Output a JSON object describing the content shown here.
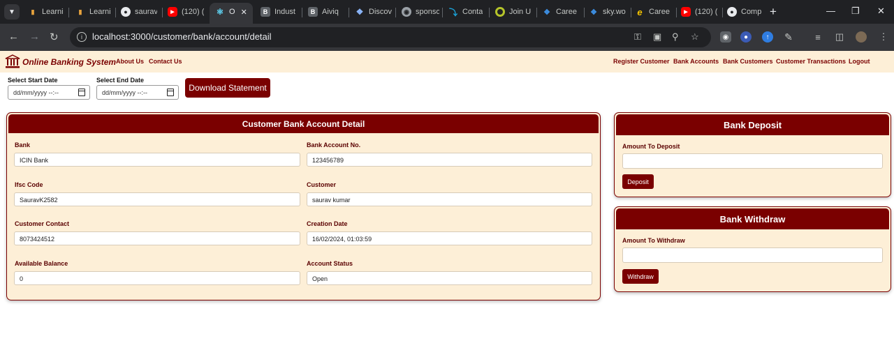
{
  "browser": {
    "tabs": [
      {
        "title": "Learni",
        "favicon": "bar-chart-icon",
        "color": "#e8a33d"
      },
      {
        "title": "Learni",
        "favicon": "bar-chart-icon",
        "color": "#e8a33d"
      },
      {
        "title": "saurav",
        "favicon": "github-icon",
        "color": "#e8eaed"
      },
      {
        "title": "(120) (",
        "favicon": "youtube-icon",
        "color": "#ff0000"
      },
      {
        "title": "O",
        "favicon": "react-icon",
        "color": "#61dafb",
        "active": true
      },
      {
        "title": "Indust",
        "favicon": "b-icon",
        "color": "#5f6368"
      },
      {
        "title": "Aiviq",
        "favicon": "b-icon",
        "color": "#5f6368"
      },
      {
        "title": "Discov",
        "favicon": "discover-icon",
        "color": "#8ab4f8"
      },
      {
        "title": "sponso",
        "favicon": "globe-icon",
        "color": "#9aa0a6"
      },
      {
        "title": "Conta",
        "favicon": "hook-icon",
        "color": "#1aa3d9"
      },
      {
        "title": "Join U",
        "favicon": "circle-icon",
        "color": "#b5c42a"
      },
      {
        "title": "Caree",
        "favicon": "w-icon",
        "color": "#3c8de0"
      },
      {
        "title": "sky.wo",
        "favicon": "w-icon",
        "color": "#3c8de0"
      },
      {
        "title": "Caree",
        "favicon": "e-icon",
        "color": "#f5c400"
      },
      {
        "title": "(120) (",
        "favicon": "youtube-icon",
        "color": "#ff0000"
      },
      {
        "title": "Comp",
        "favicon": "github-icon",
        "color": "#e8eaed"
      }
    ],
    "url": "localhost:3000/customer/bank/account/detail"
  },
  "navbar": {
    "brand": "Online Banking System",
    "left_links": [
      "About Us",
      "Contact Us"
    ],
    "right_links": [
      "Register Customer",
      "Bank Accounts",
      "Bank Customers",
      "Customer Transactions",
      "Logout"
    ]
  },
  "filter": {
    "start_label": "Select Start Date",
    "end_label": "Select End Date",
    "date_placeholder": "dd/mm/yyyy --:--",
    "download_label": "Download Statement"
  },
  "account": {
    "title": "Customer Bank Account Detail",
    "fields": [
      {
        "label": "Bank",
        "value": "ICIN Bank"
      },
      {
        "label": "Bank Account No.",
        "value": "123456789"
      },
      {
        "label": "Ifsc Code",
        "value": "SauravK2582"
      },
      {
        "label": "Customer",
        "value": "saurav kumar"
      },
      {
        "label": "Customer Contact",
        "value": "8073424512"
      },
      {
        "label": "Creation Date",
        "value": "16/02/2024, 01:03:59"
      },
      {
        "label": "Available Balance",
        "value": "0"
      },
      {
        "label": "Account Status",
        "value": "Open"
      }
    ]
  },
  "deposit": {
    "title": "Bank Deposit",
    "label": "Amount To Deposit",
    "value": "",
    "button": "Deposit"
  },
  "withdraw": {
    "title": "Bank Withdraw",
    "label": "Amount To Withdraw",
    "value": "",
    "button": "Withdraw"
  },
  "colors": {
    "accent": "#7a0000",
    "panel": "#fdefd7"
  }
}
